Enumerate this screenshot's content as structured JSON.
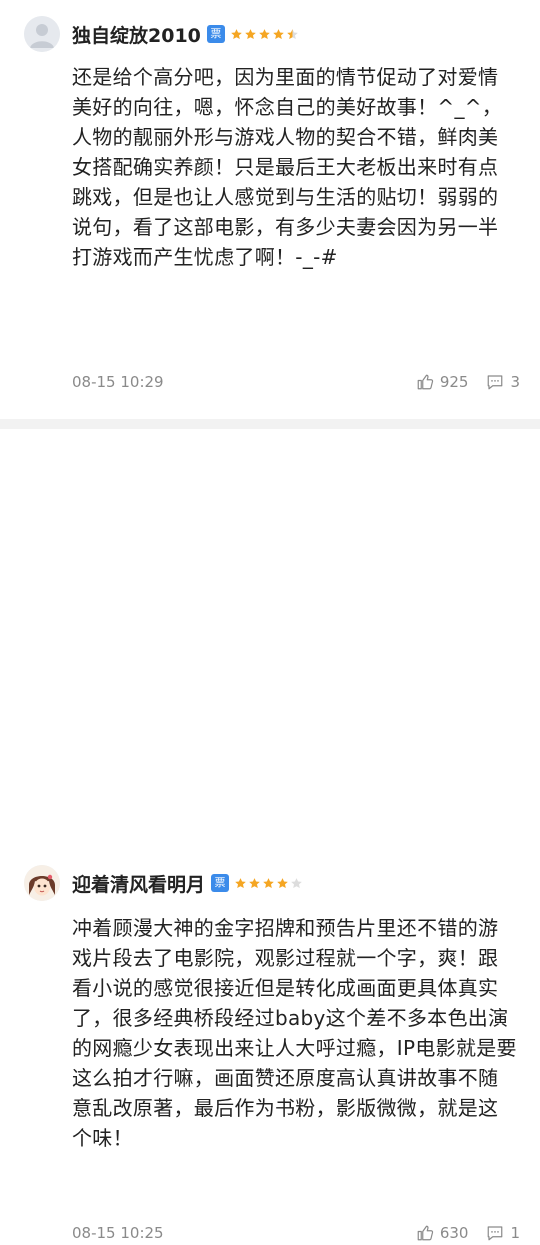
{
  "reviews": [
    {
      "username": "独自绽放2010",
      "ticket_badge": "票",
      "rating_stars": 4.5,
      "content": "还是给个高分吧，因为里面的情节促动了对爱情美好的向往，嗯，怀念自己的美好故事！^_^，人物的靓丽外形与游戏人物的契合不错，鲜肉美女搭配确实养颜！只是最后王大老板出来时有点跳戏，但是也让人感觉到与生活的贴切！弱弱的说句，看了这部电影，有多少夫妻会因为另一半打游戏而产生忧虑了啊！-_-#",
      "time": "08-15 10:29",
      "likes": "925",
      "comments": "3"
    },
    {
      "username": "迎着清风看明月",
      "ticket_badge": "票",
      "rating_stars": 4,
      "content": "冲着顾漫大神的金字招牌和预告片里还不错的游戏片段去了电影院，观影过程就一个字，爽！跟看小说的感觉很接近但是转化成画面更具体真实了，很多经典桥段经过baby这个差不多本色出演的网瘾少女表现出来让人大呼过瘾，IP电影就是要这么拍才行嘛，画面赞还原度高认真讲故事不随意乱改原著，最后作为书粉，影版微微，就是这个味！",
      "time": "08-15 10:25",
      "likes": "630",
      "comments": "1"
    }
  ],
  "colors": {
    "star_filled": "#f5a623",
    "star_empty": "#dddddd",
    "badge": "#3b8bea",
    "meta_text": "#8a8a8a",
    "divider": "#f2f2f2"
  },
  "icons": {
    "like": "thumbs-up-icon",
    "comment": "comment-icon"
  }
}
